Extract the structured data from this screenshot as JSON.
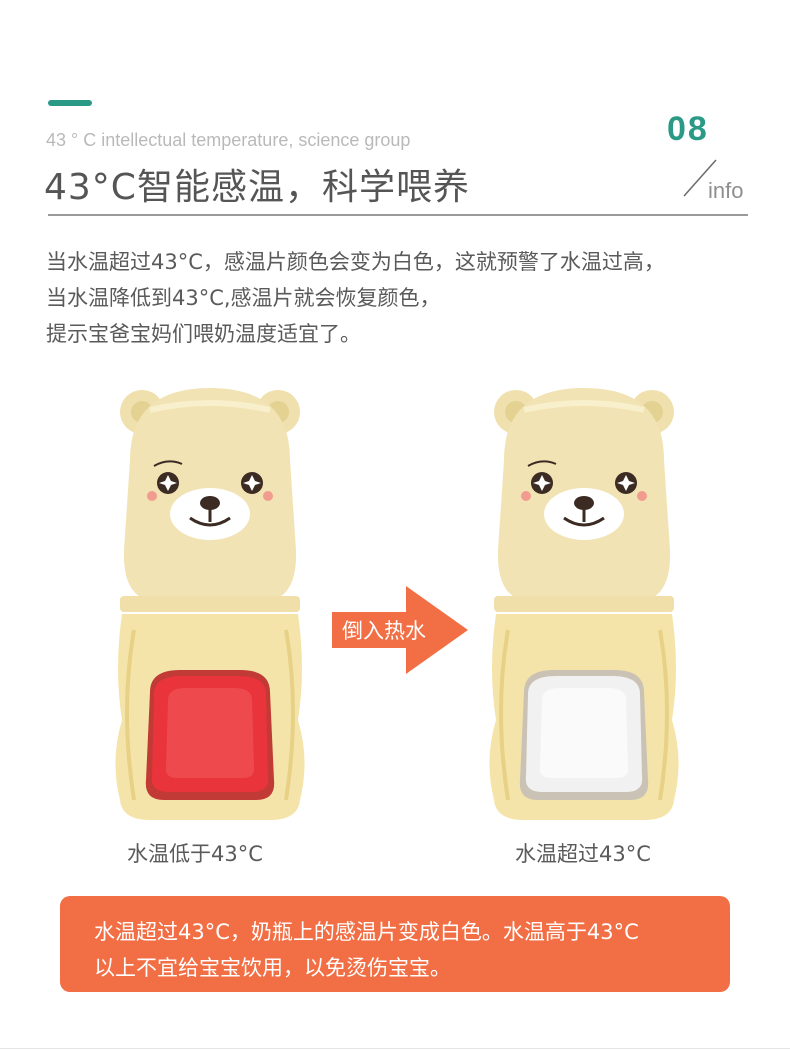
{
  "header": {
    "subtitle_en": "43 ° C intellectual temperature, science group",
    "title_cn": "43°C智能感温，科学喂养",
    "page_number": "08",
    "info_label": "info",
    "accent_color": "#2a9a86"
  },
  "description": {
    "lines": [
      "当水温超过43°C，感温片颜色会变为白色，这就预警了水温过高，",
      "当水温降低到43°C,感温片就会恢复颜色，",
      "提示宝爸宝妈们喂奶温度适宜了。"
    ]
  },
  "comparison": {
    "arrow_label": "倒入热水",
    "arrow_color": "#f26f45",
    "left_caption": "水温低于43°C",
    "right_caption": "水温超过43°C",
    "left_sensor_color": "#e8343a",
    "right_sensor_color": "#f1f1f1"
  },
  "note": {
    "line1": "水温超过43°C，奶瓶上的感温片变成白色。水温高于43°C",
    "line2": "以上不宜给宝宝饮用，以免烫伤宝宝。",
    "background": "#f26f45"
  }
}
